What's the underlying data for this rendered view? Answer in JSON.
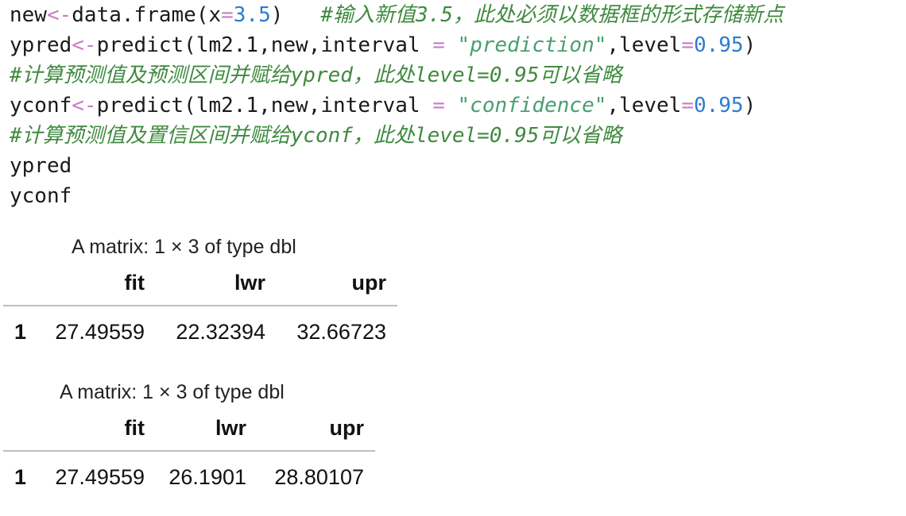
{
  "code": {
    "line1": {
      "t1": "new",
      "t2": "<-",
      "t3": "data.frame(x",
      "t4": "=",
      "t5": "3.5",
      "t6": ")   ",
      "comment": "#输入新值3.5，此处必须以数据框的形式存储新点"
    },
    "line2": {
      "t1": "ypred",
      "t2": "<-",
      "t3": "predict(lm2.1,new,interval ",
      "t4": "=",
      "t5": " ",
      "t6": "\"prediction\"",
      "t7": ",level",
      "t8": "=",
      "t9": "0.95",
      "t10": ")"
    },
    "line3": {
      "comment": "#计算预测值及预测区间并赋给ypred，此处level=0.95可以省略"
    },
    "line4": {
      "t1": "yconf",
      "t2": "<-",
      "t3": "predict(lm2.1,new,interval ",
      "t4": "=",
      "t5": " ",
      "t6": "\"confidence\"",
      "t7": ",level",
      "t8": "=",
      "t9": "0.95",
      "t10": ")"
    },
    "line5": {
      "comment": "#计算预测值及置信区间并赋给yconf，此处level=0.95可以省略"
    },
    "line6": {
      "text": "ypred"
    },
    "line7": {
      "text": "yconf"
    }
  },
  "outputs": [
    {
      "caption": "A matrix: 1 × 3 of type dbl",
      "columns": [
        "fit",
        "lwr",
        "upr"
      ],
      "rows": [
        {
          "label": "1",
          "values": [
            "27.49559",
            "22.32394",
            "32.66723"
          ]
        }
      ]
    },
    {
      "caption": "A matrix: 1 × 3 of type dbl",
      "columns": [
        "fit",
        "lwr",
        "upr"
      ],
      "rows": [
        {
          "label": "1",
          "values": [
            "27.49559",
            "26.1901",
            "28.80107"
          ]
        }
      ]
    }
  ],
  "colors": {
    "operator": "#c77dc4",
    "number": "#2c7cd1",
    "string": "#4a9e72",
    "comment": "#3f8a3f",
    "table_rule": "#bfbfbf"
  }
}
